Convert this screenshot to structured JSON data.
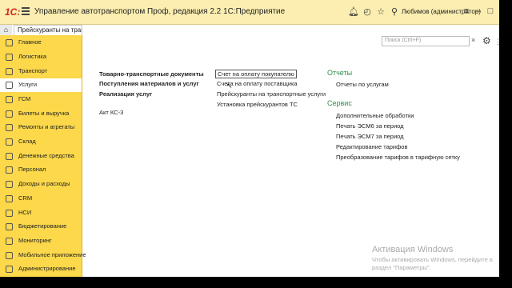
{
  "titlebar": {
    "logo": "1С:",
    "title": "Управление автотранспортом Проф, редакция 2.2 1С:Предприятие",
    "user": "Любимов (администратор)"
  },
  "tabs": {
    "open_tab": "Прейскуранты на транспорт"
  },
  "sidebar": {
    "items": [
      {
        "label": "Главное"
      },
      {
        "label": "Логистика"
      },
      {
        "label": "Транспорт"
      },
      {
        "label": "Услуги"
      },
      {
        "label": "ГСМ"
      },
      {
        "label": "Билеты и выручка"
      },
      {
        "label": "Ремонты и агрегаты"
      },
      {
        "label": "Склад"
      },
      {
        "label": "Денежные средства"
      },
      {
        "label": "Персонал"
      },
      {
        "label": "Доходы и расходы"
      },
      {
        "label": "CRM"
      },
      {
        "label": "НСИ"
      },
      {
        "label": "Бюджетирование"
      },
      {
        "label": "Мониторинг"
      },
      {
        "label": "Мобильное приложение"
      },
      {
        "label": "Администрирование"
      }
    ]
  },
  "search": {
    "placeholder": "Поиск (Ctrl+F)"
  },
  "column1": {
    "bold": [
      "Товарно-транспортные документы",
      "Поступления материалов и услуг",
      "Реализация услуг"
    ],
    "links": [
      "Акт КС-3"
    ]
  },
  "column2": {
    "links": [
      "Счет на оплату покупателю",
      "Счета на оплату поставщика",
      "Прейскуранты на транспортные услуги",
      "Установка прейскурантов ТС"
    ]
  },
  "column3": {
    "reports_title": "Отчеты",
    "reports": [
      "Отчеты по услугам"
    ],
    "service_title": "Сервис",
    "service": [
      "Дополнительные обработки",
      "Печать ЭСМ6 за период",
      "Печать ЭСМ7 за период",
      "Редактирование тарифов",
      "Преобразование тарифов в тарифную сетку"
    ]
  },
  "watermark": {
    "line1": "Активация Windows",
    "line2": "Чтобы активировать Windows, перейдите в",
    "line3": "раздел \"Параметры\"."
  }
}
